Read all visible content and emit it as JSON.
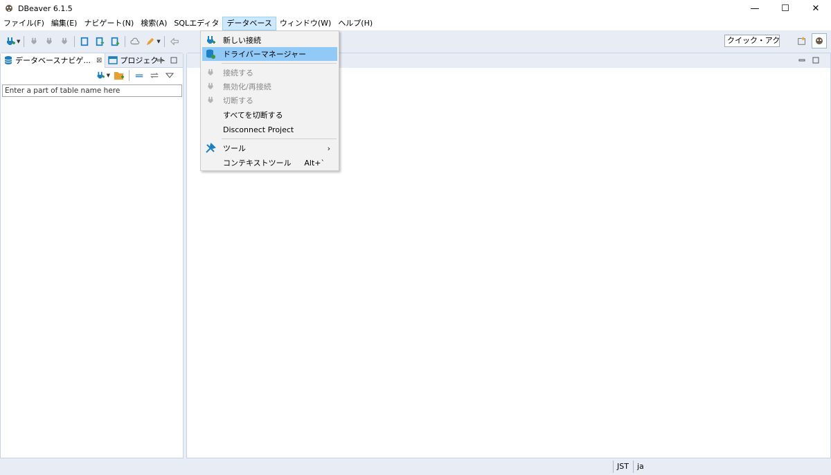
{
  "window": {
    "title": "DBeaver 6.1.5",
    "minimize": "—",
    "maximize": "☐",
    "close": "✕"
  },
  "menubar": [
    "ファイル(F)",
    "編集(E)",
    "ナビゲート(N)",
    "検索(A)",
    "SQLエディタ",
    "データベース",
    "ウィンドウ(W)",
    "ヘルプ(H)"
  ],
  "toolbar": {
    "quick_access": "クイック・アクセス"
  },
  "left_panel": {
    "tabs": [
      {
        "label": "データベースナビゲ..."
      },
      {
        "label": "プロジェクト"
      }
    ],
    "filter_placeholder": "Enter a part of table name here"
  },
  "database_menu": {
    "items": [
      {
        "label": "新しい接続",
        "icon": "new-connection-icon",
        "enabled": true
      },
      {
        "label": "ドライバーマネージャー",
        "icon": "driver-manager-icon",
        "enabled": true,
        "highlighted": true
      },
      {
        "label": "接続する",
        "icon": "connect-icon",
        "enabled": false
      },
      {
        "label": "無効化/再接続",
        "icon": "reconnect-icon",
        "enabled": false
      },
      {
        "label": "切断する",
        "icon": "disconnect-icon",
        "enabled": false
      },
      {
        "label": "すべてを切断する",
        "enabled": true
      },
      {
        "label": "Disconnect Project",
        "enabled": true
      },
      {
        "label": "ツール",
        "icon": "tools-icon",
        "enabled": true,
        "submenu": true
      },
      {
        "label": "コンテキストツール",
        "accelerator": "Alt+`",
        "enabled": true
      }
    ]
  },
  "status": {
    "timezone": "JST",
    "locale": "ja"
  },
  "colors": {
    "highlight": "#91c9f7",
    "accent": "#1a7fc4",
    "active_menu_bg": "#cce8ff"
  }
}
